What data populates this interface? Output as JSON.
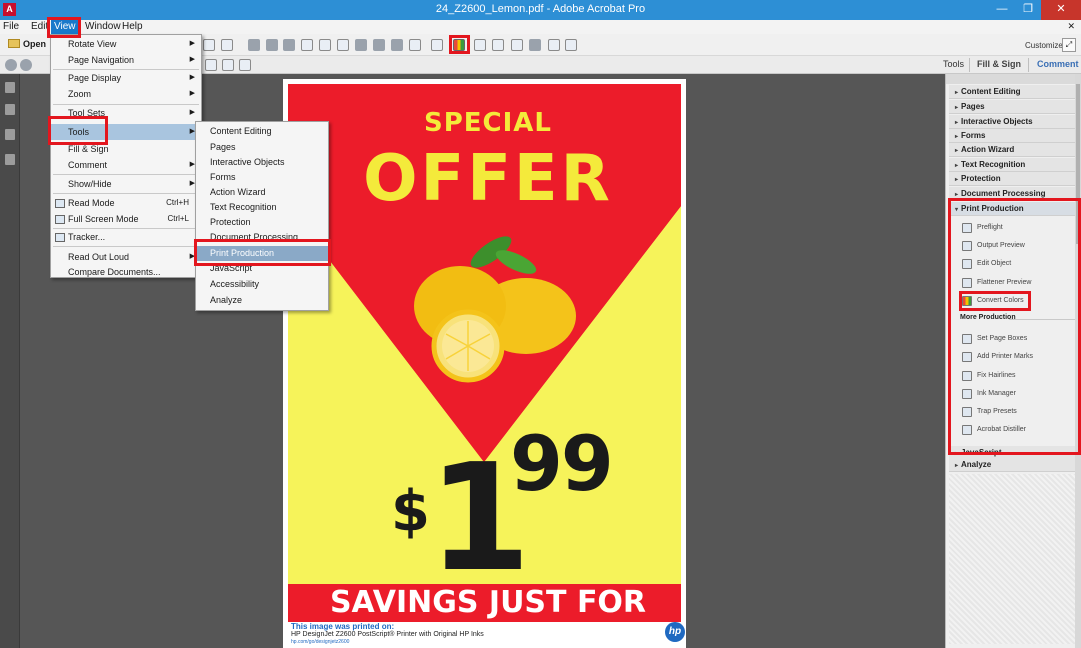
{
  "window": {
    "title": "24_Z2600_Lemon.pdf - Adobe Acrobat Pro",
    "minimize": "—",
    "maximize": "❐",
    "close": "✕"
  },
  "menubar": {
    "items": [
      "File",
      "Edit",
      "View",
      "Window",
      "Help"
    ],
    "close_doc": "✕"
  },
  "toolbar": {
    "open_label": "Open",
    "customize_label": "Customize",
    "customize_arrow": "▾"
  },
  "tabs": {
    "tools": "Tools",
    "fill_sign": "Fill & Sign",
    "comment": "Comment"
  },
  "view_menu": {
    "items": [
      {
        "label": "Rotate View",
        "submenu": true
      },
      {
        "label": "Page Navigation",
        "submenu": true
      },
      {
        "label": "Page Display",
        "submenu": true
      },
      {
        "label": "Zoom",
        "submenu": true
      },
      {
        "label": "Tool Sets",
        "submenu": true
      },
      {
        "label": "Tools",
        "submenu": true,
        "highlighted": true
      },
      {
        "label": "Fill & Sign",
        "submenu": false
      },
      {
        "label": "Comment",
        "submenu": true
      },
      {
        "label": "Show/Hide",
        "submenu": true
      },
      {
        "label": "Read Mode",
        "shortcut": "Ctrl+H"
      },
      {
        "label": "Full Screen Mode",
        "shortcut": "Ctrl+L"
      },
      {
        "label": "Tracker..."
      },
      {
        "label": "Read Out Loud",
        "submenu": true
      },
      {
        "label": "Compare Documents..."
      }
    ],
    "arrow": "▶"
  },
  "tools_submenu": {
    "items": [
      "Content Editing",
      "Pages",
      "Interactive Objects",
      "Forms",
      "Action Wizard",
      "Text Recognition",
      "Protection",
      "Document Processing",
      "Print Production",
      "JavaScript",
      "Accessibility",
      "Analyze"
    ],
    "highlighted": "Print Production"
  },
  "poster": {
    "special": "SPECIAL",
    "offer": "OFFER",
    "dollar": "$",
    "price_main": "1",
    "price_cents": "99",
    "savings": "SAVINGS JUST FOR YOU!",
    "footer_line1": "This image was printed on:",
    "footer_line2": "HP DesignJet Z2600  PostScript® Printer with Original HP Inks",
    "footer_line3": "hp.com/go/designjetz2600",
    "hp_logo": "hp",
    "colors": {
      "red": "#ec1c2a",
      "yellow": "#f6f35a",
      "lemon": "#f4c31a"
    }
  },
  "right_panel": {
    "sections_before": [
      "Content Editing",
      "Pages",
      "Interactive Objects",
      "Forms",
      "Action Wizard",
      "Text Recognition",
      "Protection",
      "Document Processing"
    ],
    "open_section": "Print Production",
    "print_production_items": [
      {
        "label": "Preflight",
        "icon": "preflight-icon"
      },
      {
        "label": "Output Preview",
        "icon": "output-preview-icon"
      },
      {
        "label": "Edit Object",
        "icon": "edit-object-icon"
      },
      {
        "label": "Flattener Preview",
        "icon": "flattener-preview-icon"
      },
      {
        "label": "Convert Colors",
        "icon": "convert-colors-icon"
      }
    ],
    "more_production_label": "More Production",
    "more_production_items": [
      {
        "label": "Set Page Boxes",
        "icon": "set-page-boxes-icon"
      },
      {
        "label": "Add Printer Marks",
        "icon": "add-printer-marks-icon"
      },
      {
        "label": "Fix Hairlines",
        "icon": "fix-hairlines-icon"
      },
      {
        "label": "Ink Manager",
        "icon": "ink-manager-icon"
      },
      {
        "label": "Trap Presets",
        "icon": "trap-presets-icon"
      },
      {
        "label": "Acrobat Distiller",
        "icon": "acrobat-distiller-icon"
      }
    ],
    "sections_after": [
      "JavaScript",
      "Analyze"
    ],
    "collapsed_tri": "▸",
    "expanded_tri": "▾"
  },
  "accent_red": "#e3161e"
}
